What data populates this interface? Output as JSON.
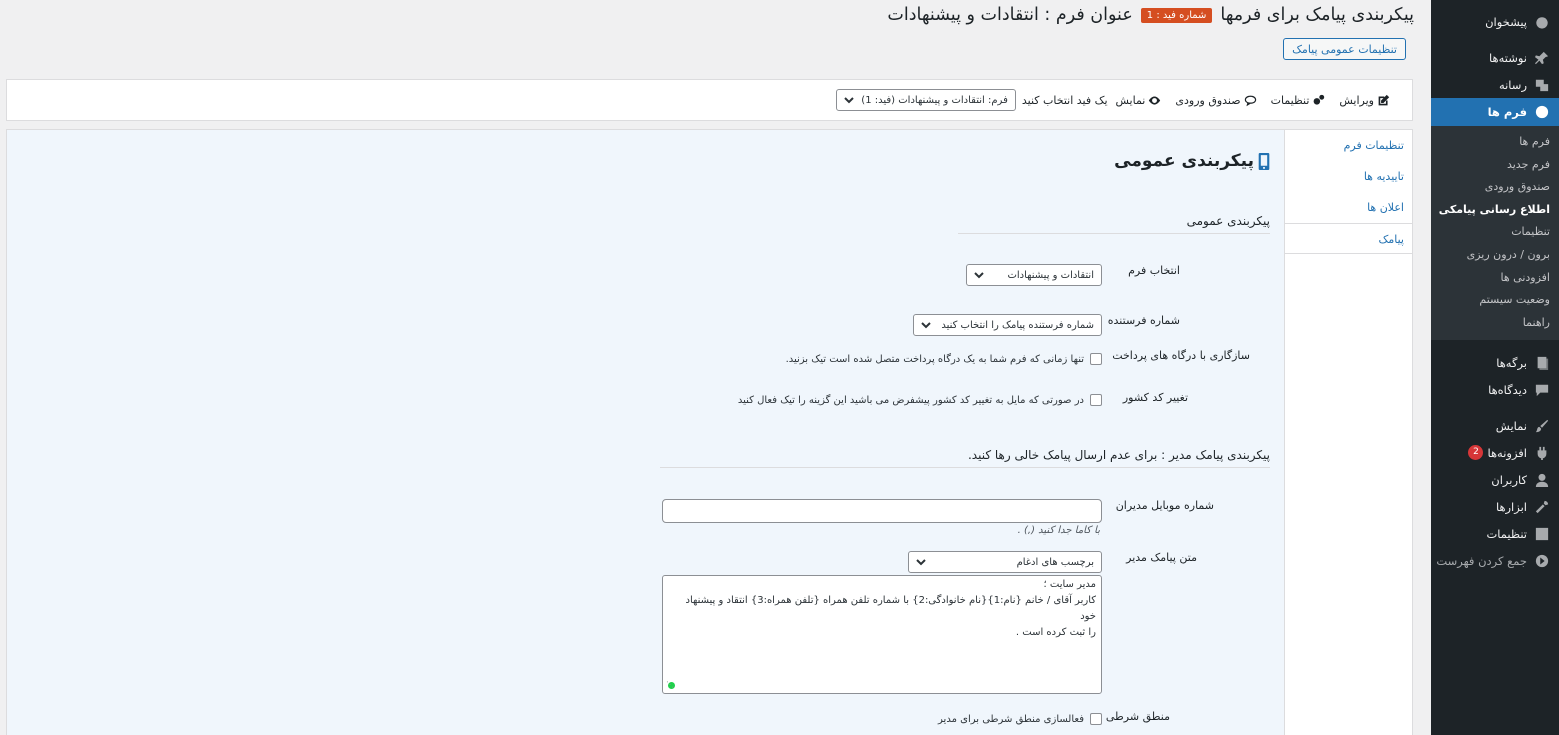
{
  "header": {
    "title": "پیکربندی پیامک برای فرمها",
    "feed_badge": "شماره فید : 1",
    "form_title": "عنوان فرم : انتقادات و پیشنهادات",
    "general_settings_button": "تنظیمات عمومی پیامک"
  },
  "toolbar": {
    "edit": "ویرایش",
    "settings": "تنظیمات",
    "inbox": "صندوق ورودی",
    "preview": "نمایش",
    "select_feed_label": "یک فید انتخاب کنید",
    "feed_select_value": "فرم: انتقادات و پیشنهادات (فید: 1)"
  },
  "settings_nav": {
    "items": [
      {
        "label": "تنظیمات فرم"
      },
      {
        "label": "تاییدیه ها"
      },
      {
        "label": "اعلان ها"
      },
      {
        "label": "پیامک"
      }
    ]
  },
  "content": {
    "title": "پیکربندی عمومی",
    "general_heading": "پیکربندی عمومی",
    "select_form_label": "انتخاب فرم",
    "select_form_value": "انتقادات و پیشنهادات",
    "sender_number_label": "شماره فرستنده",
    "sender_number_value": "شماره فرستنده پیامک را انتخاب کنید",
    "payment_label": "سازگاری با درگاه های پرداخت",
    "payment_text": "تنها زمانی که فرم شما به یک درگاه پرداخت متصل شده است تیک بزنید.",
    "country_code_label": "تغییر کد کشور",
    "country_code_text": "در صورتی که مایل به تغییر کد کشور پیشفرض می باشید این گزینه را تیک فعال کنید",
    "admin_heading": "پیکربندی پیامک مدیر : برای عدم ارسال پیامک خالی رها کنید.",
    "admin_mobile_label": "شماره موبایل مدیران",
    "admin_mobile_value": "",
    "admin_mobile_hint": "با کاما جدا کنید (,) .",
    "admin_message_label": "متن پیامک مدیر",
    "merge_tags_value": "برچسب های ادغام",
    "admin_message_lines": [
      "مدیر سایت ؛",
      "کاربر آقای / خانم {نام:1}{نام خانوادگی:2} با شماره تلفن همراه {تلفن همراه:3} انتقاد و پیشنهاد خود",
      "را ثبت کرده است ."
    ],
    "conditional_label": "منطق شرطی",
    "conditional_text": "فعالسازی منطق شرطی برای مدیر"
  },
  "sidebar": {
    "items": [
      {
        "label": "پیشخوان",
        "icon": "dashboard-icon"
      },
      {
        "label": "نوشته‌ها",
        "icon": "pin-icon"
      },
      {
        "label": "رسانه",
        "icon": "media-icon"
      },
      {
        "label": "فرم ها",
        "icon": "forms-icon"
      },
      {
        "label": "برگه‌ها",
        "icon": "pages-icon"
      },
      {
        "label": "دیدگاه‌ها",
        "icon": "comments-icon"
      },
      {
        "label": "نمایش",
        "icon": "appearance-icon"
      },
      {
        "label": "افزونه‌ها",
        "icon": "plugins-icon",
        "badge": "2"
      },
      {
        "label": "کاربران",
        "icon": "users-icon"
      },
      {
        "label": "ابزارها",
        "icon": "tools-icon"
      },
      {
        "label": "تنظیمات",
        "icon": "settings-icon"
      },
      {
        "label": "جمع کردن فهرست",
        "icon": "collapse-icon"
      }
    ],
    "forms_submenu": [
      {
        "label": "فرم ها"
      },
      {
        "label": "فرم جدید"
      },
      {
        "label": "صندوق ورودی"
      },
      {
        "label": "اطلاع رسانی پیامکی"
      },
      {
        "label": "تنظیمات"
      },
      {
        "label": "برون / درون ریزی"
      },
      {
        "label": "افزودنی ها"
      },
      {
        "label": "وضعیت سیستم"
      },
      {
        "label": "راهنما"
      }
    ]
  },
  "colors": {
    "accent": "#2271b1",
    "sidebar_bg": "#1d2327",
    "badge": "#d54e21",
    "content_bg": "#f0f6fc"
  }
}
